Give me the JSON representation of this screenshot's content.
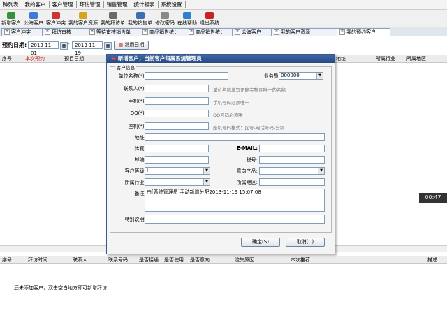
{
  "menu": [
    "钟列表",
    "我的客户",
    "客户管理",
    "拜访管理",
    "销售管理",
    "统计报表",
    "系统设置"
  ],
  "toolbar": [
    {
      "label": "新增客户",
      "icon": "add-customer-icon",
      "color": "#3a8f3a"
    },
    {
      "label": "公海客户",
      "icon": "globe-icon",
      "color": "#3d7bd6"
    },
    {
      "label": "客户冲突",
      "icon": "conflict-icon",
      "color": "#c33"
    },
    {
      "label": "我的客户资源",
      "icon": "folder-icon",
      "color": "#d9a520"
    },
    {
      "label": "我的拜访单",
      "icon": "visit-icon",
      "color": "#6a6a6a"
    },
    {
      "label": "我的销售单",
      "icon": "sales-icon",
      "color": "#3a6fb0"
    },
    {
      "label": "修改密码",
      "icon": "key-icon",
      "color": "#888"
    },
    {
      "label": "在线帮助",
      "icon": "help-icon",
      "color": "#2f7fd0"
    },
    {
      "label": "退出系统",
      "icon": "exit-icon",
      "color": "#c22"
    }
  ],
  "tabs": [
    "客户冲突",
    "拜访审核",
    "等待审核销售单",
    "商品销售统计",
    "商品销售统计",
    "公海客户",
    "我的客户资源",
    "我的预约客户"
  ],
  "date_row": {
    "label": "预约日期:",
    "from": "2013-11-01",
    "to": "2013-11-19",
    "button": "常用日期"
  },
  "top_grid_headers": [
    "序号",
    "本次预约",
    "预目日期"
  ],
  "right_grid_headers": [
    "地址",
    "所属行业",
    "所属地区"
  ],
  "bottom_grid_headers": [
    "序号",
    "拜访时间",
    "联系人",
    "联系号码",
    "是否接通",
    "是否使用",
    "是否意向",
    "流失原因",
    "本次推荐",
    "描述"
  ],
  "bottom_hint": "还未添加客户，双击空白地方即可新增拜访",
  "timer": "00:47",
  "dialog": {
    "title": "新增客户，当前客户归属系统管理员",
    "group_label": "客户信息",
    "fields": {
      "company": {
        "label": "单位名称(*):",
        "value": "",
        "hint": ""
      },
      "salesman": {
        "label": "业务员:",
        "value": "000000"
      },
      "contact": {
        "label": "联系人(*):",
        "value": "",
        "hint": "单位名称填写正确完整且唯一的名称"
      },
      "mobile": {
        "label": "手机(*):",
        "value": "",
        "hint": "手机号码必须唯一"
      },
      "qq": {
        "label": "QQ(*):",
        "value": "",
        "hint": "QQ号码必须唯一"
      },
      "phone": {
        "label": "座机(*):",
        "value": "",
        "hint": "座机号码格式：区号-电话号码-分机"
      },
      "address": {
        "label": "地址:",
        "value": ""
      },
      "fax": {
        "label": "传真:",
        "value": ""
      },
      "email": {
        "label": "E-MAIL:",
        "value": ""
      },
      "postcode": {
        "label": "邮编:",
        "value": ""
      },
      "tax": {
        "label": "税号:",
        "value": ""
      },
      "level": {
        "label": "客户等级:",
        "value": "I"
      },
      "product": {
        "label": "意向产品:",
        "value": ""
      },
      "industry": {
        "label": "所属行业:",
        "value": ""
      },
      "region": {
        "label": "所属地区:",
        "value": ""
      },
      "remark": {
        "label": "备注:",
        "value": "由[系统管理员]手动新增分配2013-11-19 15:07:08"
      },
      "special": {
        "label": "特别说明:",
        "value": ""
      }
    },
    "ok_label": "确定(S)",
    "cancel_label": "取消(C)"
  }
}
